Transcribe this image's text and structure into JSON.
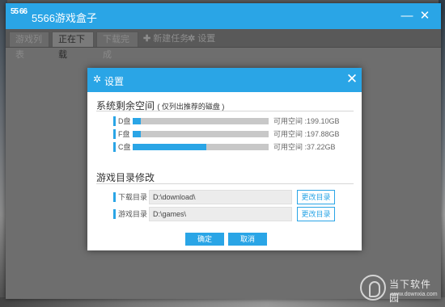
{
  "app": {
    "title": "5566游戏盒子",
    "logo_text": "55 66",
    "accent_color": "#2aa5e6"
  },
  "tabs": [
    {
      "label": "游戏列表",
      "active": false
    },
    {
      "label": "正在下载",
      "active": true
    },
    {
      "label": "下载完成",
      "active": false
    }
  ],
  "toolbar": {
    "new_task": "新建任务",
    "settings": "设置"
  },
  "dialog": {
    "title": "设置",
    "disk_section": {
      "title": "系统剩余空间",
      "note": "( 仅列出推荐的磁盘 )",
      "disks": [
        {
          "name": "D盘",
          "used_fraction": 0.06,
          "free_text": "可用空间 :199.10GB"
        },
        {
          "name": "F盘",
          "used_fraction": 0.06,
          "free_text": "可用空间 :197.88GB"
        },
        {
          "name": "C盘",
          "used_fraction": 0.54,
          "free_text": "可用空间 :37.22GB"
        }
      ]
    },
    "dir_section": {
      "title": "游戏目录修改",
      "rows": [
        {
          "label": "下载目录",
          "value": "D:\\download\\",
          "button": "更改目录"
        },
        {
          "label": "游戏目录",
          "value": "D:\\games\\",
          "button": "更改目录"
        }
      ]
    },
    "confirm": "确定",
    "cancel": "取消"
  },
  "watermark": {
    "text": "当下软件园",
    "url": "www.downxia.com"
  }
}
